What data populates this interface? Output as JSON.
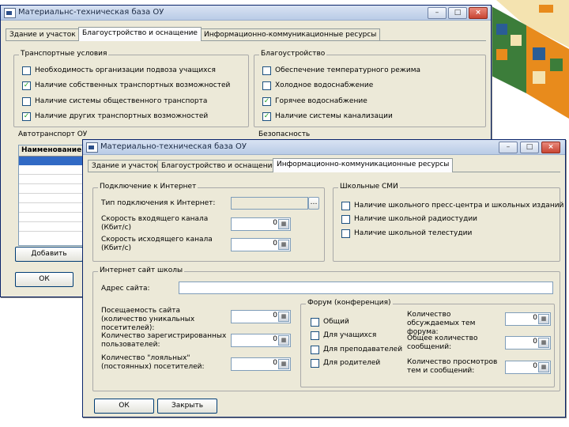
{
  "cube_colors": {
    "orange": "#e88b1c",
    "green": "#3c7d3a",
    "blue": "#2a5d95",
    "cream": "#f4e3b0"
  },
  "back_window": {
    "title": "Материальнс-техническая база ОУ",
    "tabs": [
      "Здание и участок",
      "Благоустройство и оснащение",
      "Информационно-коммуникационные ресурсы"
    ],
    "transport": {
      "label": "Транспортные условия",
      "items": [
        {
          "label": "Необходимость организации подвоза учащихся",
          "checked": false
        },
        {
          "label": "Наличие собственных транспортных возможностей",
          "checked": true
        },
        {
          "label": "Наличие системы общественного транспорта",
          "checked": false
        },
        {
          "label": "Наличие других транспортных возможностей",
          "checked": true
        }
      ]
    },
    "improvement": {
      "label": "Благоустройство",
      "items": [
        {
          "label": "Обеспечение температурного режима",
          "checked": false
        },
        {
          "label": "Холодное водоснабжение",
          "checked": false
        },
        {
          "label": "Горячее водоснабжение",
          "checked": true
        },
        {
          "label": "Наличие системы канализации",
          "checked": true
        }
      ]
    },
    "autotransport_label": "Автотранспорт ОУ",
    "table_header": "Наименование",
    "security_label": "Безопасность",
    "add_button": "Добавить",
    "ok_button": "ОК"
  },
  "front_window": {
    "title": "Материально-техническая база ОУ",
    "tabs": [
      "Здание и участок",
      "Благоустройство и оснащение",
      "Информационно-коммуникационные ресурсы"
    ],
    "internet": {
      "label": "Подключение к Интернет",
      "type_label": "Тип подключения к Интернет:",
      "in_speed_label": "Скорость входящего канала (Кбит/с)",
      "in_speed_value": "0",
      "out_speed_label": "Скорость исходящего канала (Кбит/с)",
      "out_speed_value": "0"
    },
    "media": {
      "label": "Школьные СМИ",
      "items": [
        {
          "label": "Наличие школьного пресс-центра и школьных изданий",
          "checked": false
        },
        {
          "label": "Наличие школьной радиостудии",
          "checked": false
        },
        {
          "label": "Наличие школьной телестудии",
          "checked": false
        }
      ]
    },
    "site": {
      "label": "Интернет сайт школы",
      "address_label": "Адрес сайта:",
      "visits_label": "Посещаемость сайта (количество уникальных посетителей):",
      "visits_value": "0",
      "registered_label": "Количество зарегистрированных пользователей:",
      "registered_value": "0",
      "loyal_label": "Количество \"лояльных\" (постоянных) посетителей:",
      "loyal_value": "0"
    },
    "forum": {
      "label": "Форум (конференция)",
      "items": [
        {
          "label": "Общий",
          "checked": false
        },
        {
          "label": "Для учащихся",
          "checked": false
        },
        {
          "label": "Для преподавателей",
          "checked": false
        },
        {
          "label": "Для родителей",
          "checked": false
        }
      ],
      "topics_label": "Количество обсуждаемых тем форума:",
      "topics_value": "0",
      "messages_label": "Общее количество сообщений:",
      "messages_value": "0",
      "views_label": "Количество просмотров тем и сообщений:",
      "views_value": "0"
    },
    "ok_button": "ОК",
    "close_button": "Закрыть"
  }
}
